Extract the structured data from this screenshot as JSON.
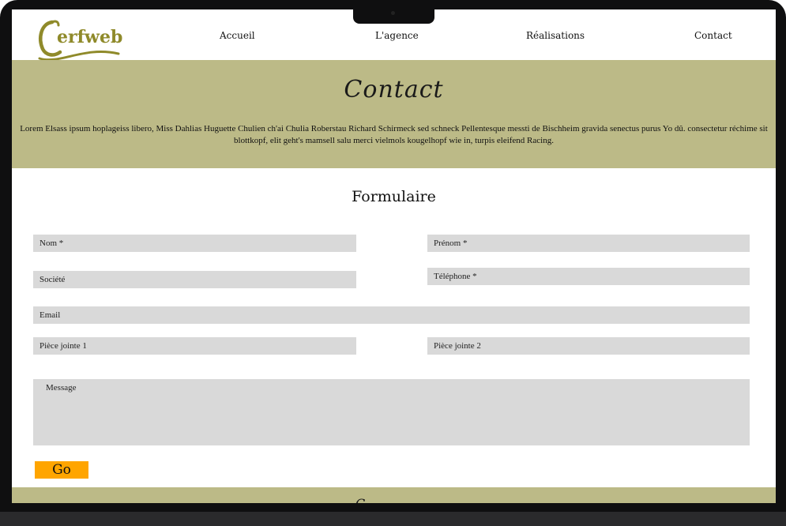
{
  "brand": {
    "logo_text": "Cerfweb",
    "logo_color": "#8f8a2a"
  },
  "nav": {
    "items": [
      {
        "label": "Accueil"
      },
      {
        "label": "L'agence"
      },
      {
        "label": "Réalisations"
      },
      {
        "label": "Contact"
      }
    ]
  },
  "hero": {
    "title": "Contact",
    "text": "Lorem Elsass ipsum hoplageiss libero, Miss Dahlias Huguette Chulien ch'ai Chulia Roberstau Richard Schirmeck sed schneck Pellentesque messti de Bischheim gravida senectus purus Yo dû. consectetur réchime sit blottkopf, elit geht's mamsell salu merci vielmols kougelhopf wie in, turpis eleifend Racing.",
    "background": "#bcba87"
  },
  "form": {
    "title": "Formulaire",
    "fields": {
      "nom": {
        "placeholder": "Nom *"
      },
      "prenom": {
        "placeholder": "Prénom *"
      },
      "societe": {
        "placeholder": "Société"
      },
      "telephone": {
        "placeholder": "Téléphone *"
      },
      "email": {
        "placeholder": "Email"
      },
      "piece1": {
        "placeholder": "Pièce jointe 1"
      },
      "piece2": {
        "placeholder": "Pièce jointe 2"
      },
      "message": {
        "placeholder": "Message"
      }
    },
    "submit_label": "Go",
    "submit_color": "#ffa500"
  },
  "footer": {
    "glyph": "C"
  }
}
